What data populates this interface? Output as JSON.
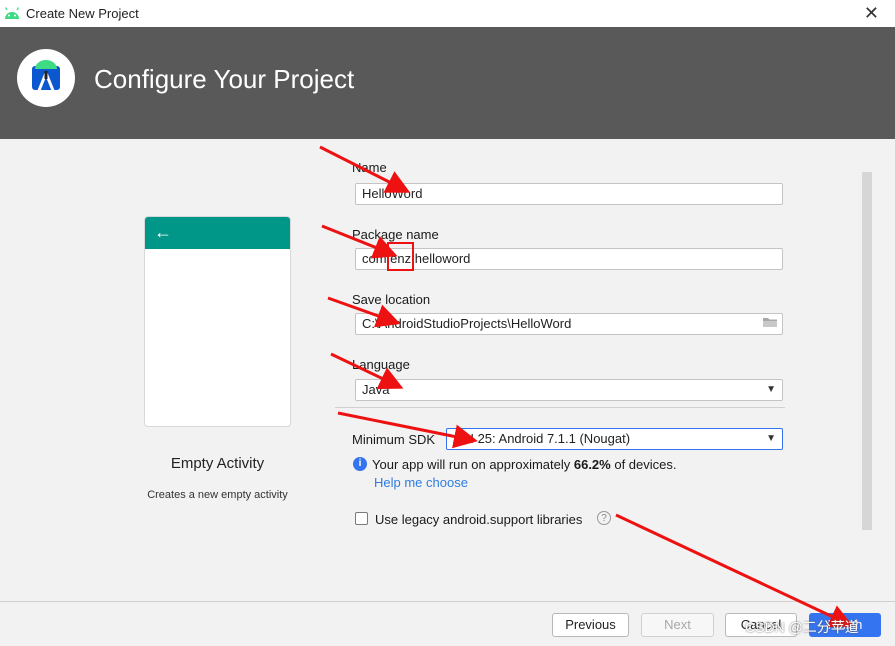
{
  "window": {
    "title": "Create New Project",
    "close_glyph": "✕"
  },
  "header": {
    "title": "Configure Your Project"
  },
  "template": {
    "name": "Empty Activity",
    "description": "Creates a new empty activity",
    "back_glyph": "←"
  },
  "form": {
    "name_label": "Name",
    "name_value": "HelloWord",
    "package_label": "Package name",
    "package_value": "com.enz.helloword",
    "location_label": "Save location",
    "location_value": "C:\\AndroidStudioProjects\\HelloWord",
    "language_label": "Language",
    "language_value": "Java",
    "sdk_label": "Minimum SDK",
    "sdk_value": "API 25: Android 7.1.1 (Nougat)"
  },
  "info": {
    "text_before": "Your app will run on approximately ",
    "percent": "66.2%",
    "text_after": " of devices.",
    "help_link": "Help me choose",
    "icon_glyph": "i"
  },
  "legacy": {
    "label": "Use legacy android.support libraries",
    "checked": false,
    "help_glyph": "?"
  },
  "buttons": {
    "previous": "Previous",
    "next": "Next",
    "cancel": "Cancel",
    "finish": "Finish"
  },
  "watermark": "CSDN @二分苹道",
  "colors": {
    "header_bg": "#595959",
    "accent": "#3574f0",
    "preview_bar": "#009688",
    "annotation": "#ee1111"
  }
}
